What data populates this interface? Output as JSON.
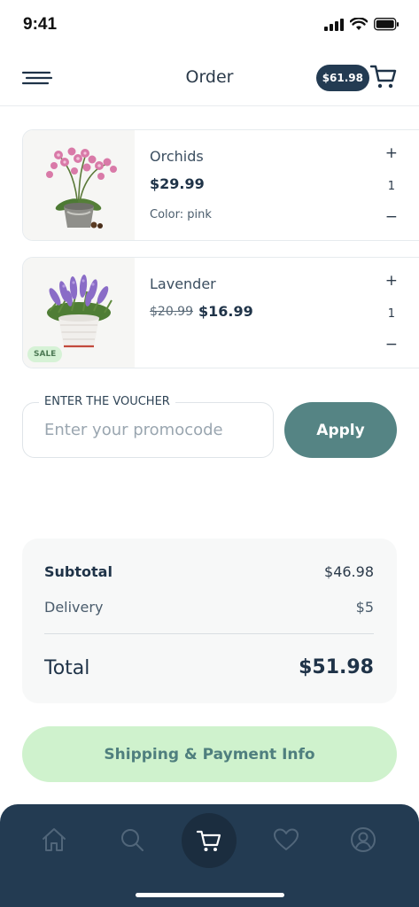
{
  "status_bar": {
    "time": "9:41"
  },
  "header": {
    "title": "Order",
    "cart_total": "$61.98"
  },
  "items": [
    {
      "name": "Orchids",
      "price": "$29.99",
      "option": "Color: pink",
      "quantity": "1",
      "plus": "+",
      "minus": "−"
    },
    {
      "name": "Lavender",
      "old_price": "$20.99",
      "price": "$16.99",
      "quantity": "1",
      "badge": "SALE",
      "plus": "+",
      "minus": "−"
    }
  ],
  "voucher": {
    "label": "ENTER THE VOUCHER",
    "placeholder": "Enter your promocode",
    "value": "",
    "apply_label": "Apply"
  },
  "summary": {
    "subtotal_label": "Subtotal",
    "subtotal_value": "$46.98",
    "delivery_label": "Delivery",
    "delivery_value": "$5",
    "total_label": "Total",
    "total_value": "$51.98"
  },
  "checkout_label": "Shipping & Payment Info",
  "nav": {
    "items": [
      "home-icon",
      "search-icon",
      "cart-icon",
      "heart-icon",
      "profile-icon"
    ],
    "active": "cart-icon"
  },
  "colors": {
    "navy": "#233b52",
    "teal": "#558484",
    "mint": "#cff2cd",
    "sale": "#d6f2d6"
  }
}
